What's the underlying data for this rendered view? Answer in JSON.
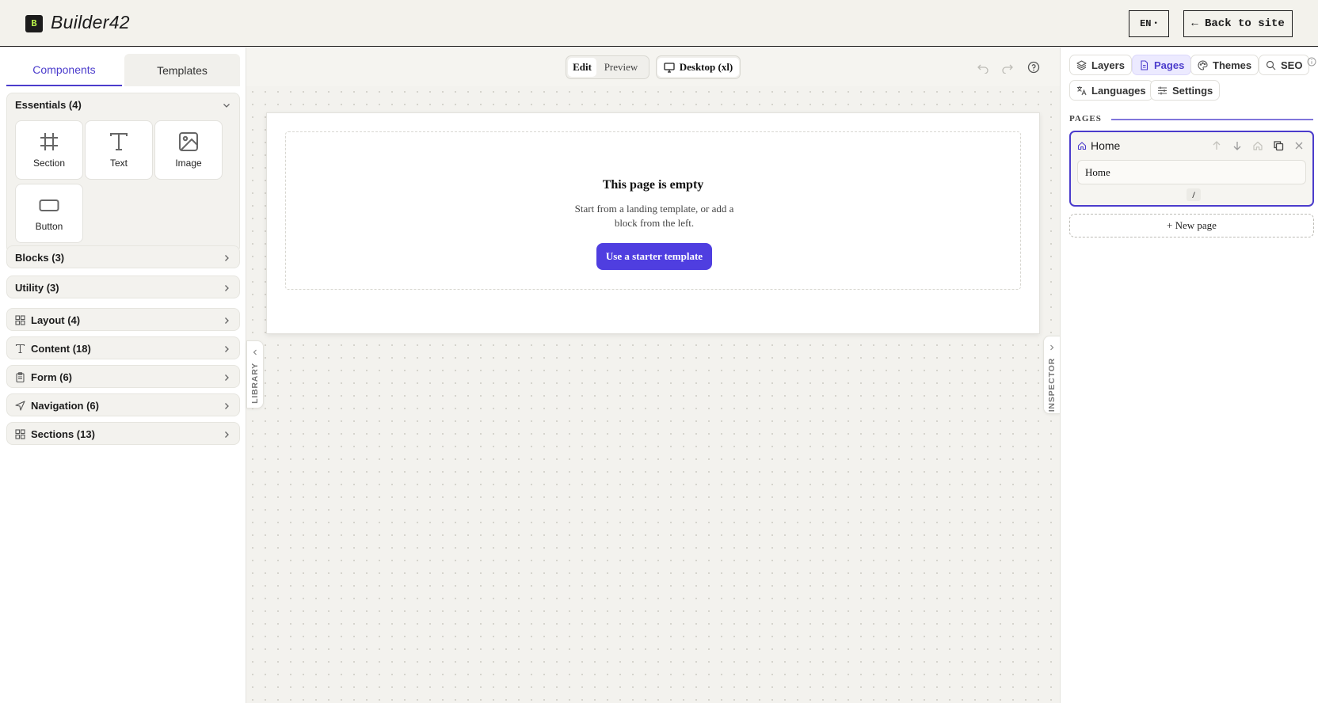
{
  "header": {
    "logo_mark": "B",
    "app_name": "Builder42",
    "language": "EN",
    "back_label": "← Back to site"
  },
  "library": {
    "tabs": [
      "Components",
      "Templates"
    ],
    "active_tab": "Components",
    "essentials": {
      "label": "Essentials (4)",
      "items": [
        {
          "label": "Section",
          "icon": "hash-icon"
        },
        {
          "label": "Text",
          "icon": "text-icon"
        },
        {
          "label": "Image",
          "icon": "image-icon"
        },
        {
          "label": "Button",
          "icon": "button-icon"
        }
      ]
    },
    "groups": [
      {
        "label": "Blocks (3)"
      },
      {
        "label": "Utility (3)"
      },
      {
        "label": "Layout (4)",
        "icon": "grid-icon"
      },
      {
        "label": "Content (18)",
        "icon": "text-icon"
      },
      {
        "label": "Form (6)",
        "icon": "clipboard-icon"
      },
      {
        "label": "Navigation (6)",
        "icon": "navigation-icon"
      },
      {
        "label": "Sections (13)",
        "icon": "grid-icon"
      }
    ],
    "side_tab": "LIBRARY"
  },
  "toolbar": {
    "edit_label": "Edit",
    "preview_label": "Preview",
    "device_label": "Desktop (xl)"
  },
  "canvas": {
    "empty_title": "This page is empty",
    "empty_desc": "Start from a landing template, or add a block from the left.",
    "starter_button": "Use a starter template"
  },
  "inspector": {
    "side_tab": "INSPECTOR",
    "tabs": [
      {
        "label": "Layers",
        "icon": "layers-icon"
      },
      {
        "label": "Pages",
        "icon": "page-icon"
      },
      {
        "label": "Themes",
        "icon": "palette-icon"
      },
      {
        "label": "SEO",
        "icon": "search-icon"
      },
      {
        "label": "Languages",
        "icon": "translate-icon"
      },
      {
        "label": "Settings",
        "icon": "sliders-icon"
      }
    ],
    "active_tab": "Pages",
    "section_label": "PAGES",
    "pages": [
      {
        "title": "Home",
        "name_value": "Home",
        "slug": "/"
      }
    ],
    "new_page_label": "+ New page"
  },
  "colors": {
    "accent": "#4b3ccc",
    "button": "#4f3ee0",
    "logo_green": "#b9f24a",
    "ink": "#1c1c1c"
  }
}
